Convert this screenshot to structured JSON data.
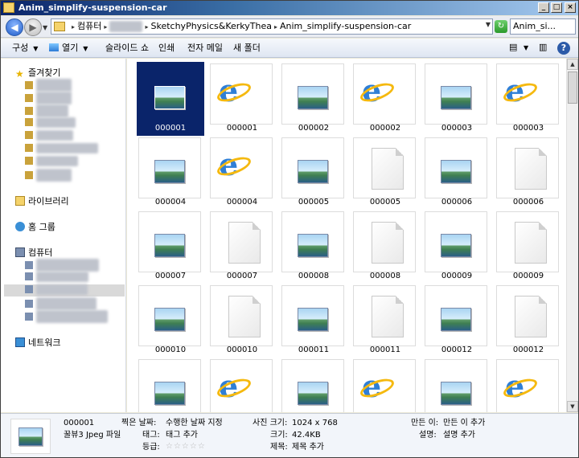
{
  "window": {
    "title": "Anim_simplify-suspension-car",
    "btn_min": "_",
    "btn_max": "□",
    "btn_close": "×"
  },
  "address": {
    "crumbs": [
      {
        "text": "컴퓨터",
        "blurred": false
      },
      {
        "text": "pumkin",
        "blurred": true
      },
      {
        "text": "SketchyPhysics&KerkyThea",
        "blurred": false
      },
      {
        "text": "Anim_simplify-suspension-car",
        "blurred": false
      }
    ],
    "search_value": "Anim_si...",
    "back_glyph": "◀",
    "fwd_glyph": "▶",
    "dropdown_glyph": "▼",
    "refresh_glyph": "↻"
  },
  "commands": [
    {
      "label": "구성",
      "arrow": true
    },
    {
      "label": "열기",
      "arrow": true
    },
    {
      "label": "슬라이드 쇼",
      "arrow": false
    },
    {
      "label": "인쇄",
      "arrow": false
    },
    {
      "label": "전자 메일",
      "arrow": false
    },
    {
      "label": "새 폴더",
      "arrow": false
    }
  ],
  "command_right": {
    "views_glyph": "▤",
    "arrow": "▼",
    "pane_glyph": "▥",
    "help": "?"
  },
  "nav": {
    "favorites": "즐겨찾기",
    "favorites_items": [
      "바탕 화면",
      "최근 장소",
      "다운로드",
      "SkyDrive",
      "Dropbox",
      "Recent Places",
      "Cloud HD",
      "저장 위치"
    ],
    "library": "라이브러리",
    "homegroup": "홈 그룹",
    "computer": "컴퓨터",
    "computer_items": [
      "로컬 디스크 (C:)",
      "Volume (D:)",
      "pumkin (E:)",
      "로컬 디스크 (F:)",
      "이동식 디스크 (G:)"
    ],
    "network": "네트워크"
  },
  "files": [
    {
      "name": "000001",
      "type": "jpg"
    },
    {
      "name": "000001",
      "type": "ie"
    },
    {
      "name": "000002",
      "type": "jpg"
    },
    {
      "name": "000002",
      "type": "ie"
    },
    {
      "name": "000003",
      "type": "jpg"
    },
    {
      "name": "000003",
      "type": "ie"
    },
    {
      "name": "000004",
      "type": "jpg"
    },
    {
      "name": "000004",
      "type": "ie"
    },
    {
      "name": "000005",
      "type": "jpg"
    },
    {
      "name": "000005",
      "type": "doc"
    },
    {
      "name": "000006",
      "type": "jpg"
    },
    {
      "name": "000006",
      "type": "doc"
    },
    {
      "name": "000007",
      "type": "jpg"
    },
    {
      "name": "000007",
      "type": "doc"
    },
    {
      "name": "000008",
      "type": "jpg"
    },
    {
      "name": "000008",
      "type": "doc"
    },
    {
      "name": "000009",
      "type": "jpg"
    },
    {
      "name": "000009",
      "type": "doc"
    },
    {
      "name": "000010",
      "type": "jpg"
    },
    {
      "name": "000010",
      "type": "doc"
    },
    {
      "name": "000011",
      "type": "jpg"
    },
    {
      "name": "000011",
      "type": "doc"
    },
    {
      "name": "000012",
      "type": "jpg"
    },
    {
      "name": "000012",
      "type": "doc"
    },
    {
      "name": "",
      "type": "jpg"
    },
    {
      "name": "",
      "type": "ie"
    },
    {
      "name": "",
      "type": "jpg"
    },
    {
      "name": "",
      "type": "ie"
    },
    {
      "name": "",
      "type": "jpg"
    },
    {
      "name": "",
      "type": "ie"
    }
  ],
  "selected_index": 0,
  "details": {
    "name": "000001",
    "filetype": "꿀뷰3 Jpeg 파일",
    "taken_label": "찍은 날짜:",
    "taken_value": "수행한 날짜 지정",
    "tags_label": "태그:",
    "tags_value": "태그 추가",
    "rating_label": "등급:",
    "rating_stars": "☆☆☆☆☆",
    "dim_label": "사진 크기:",
    "dim_value": "1024 x 768",
    "size_label": "크기:",
    "size_value": "42.4KB",
    "title_label": "제목:",
    "title_value": "제목 추가",
    "author_label": "만든 이:",
    "author_value": "만든 이 추가",
    "desc_label": "설명:",
    "desc_value": "설명 추가"
  }
}
